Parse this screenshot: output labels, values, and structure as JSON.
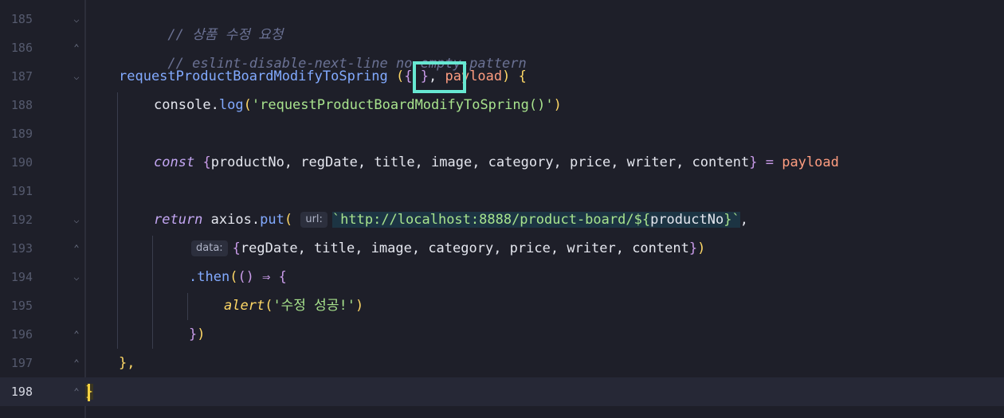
{
  "editor": {
    "current_line": "198",
    "lines": [
      {
        "n": "185",
        "comment": "// 상품 수정 요청"
      },
      {
        "n": "186",
        "comment": "// eslint-disable-next-line no-empty-pattern"
      },
      {
        "n": "187",
        "func": "requestProductBoardModifyToSpring",
        "open_paren": "(",
        "empty_pattern": "{ }",
        "comma": ",",
        "param": "payload",
        "close": ")",
        "open_brace": "{"
      },
      {
        "n": "188",
        "obj": "console",
        "dot": ".",
        "method": "log",
        "lp": "(",
        "str": "'requestProductBoardModifyToSpring()'",
        "rp": ")"
      },
      {
        "n": "189"
      },
      {
        "n": "190",
        "kw": "const",
        "lb": "{",
        "fields": "productNo, regDate, title, image, category, price, writer, content",
        "rb": "}",
        "eq": "=",
        "rhs": "payload"
      },
      {
        "n": "191"
      },
      {
        "n": "192",
        "kw": "return",
        "obj": "axios",
        "dot": ".",
        "method": "put",
        "lp": "(",
        "hint": "url:",
        "tmpl_start": "`http://localhost:8888/product-board/${",
        "tmpl_var": "productNo",
        "tmpl_end": "}`",
        "comma": ","
      },
      {
        "n": "193",
        "hint": "data:",
        "lb": "{",
        "fields": "regDate, title, image, category, price, writer, content",
        "rb": "}",
        "rp": ")"
      },
      {
        "n": "194",
        "method": ".then",
        "lp": "(",
        "args": "()",
        "arrow": "⇒",
        "lb": "{"
      },
      {
        "n": "195",
        "fn": "alert",
        "lp": "(",
        "str": "'수정 성공!'",
        "rp": ")"
      },
      {
        "n": "196",
        "rb": "}",
        "rp": ")"
      },
      {
        "n": "197",
        "rb": "},"
      },
      {
        "n": "198",
        "rb": "}"
      }
    ],
    "colors": {
      "background": "#1e1f29",
      "highlight_box": "#67e8d2",
      "cursor": "#f5d142"
    }
  }
}
